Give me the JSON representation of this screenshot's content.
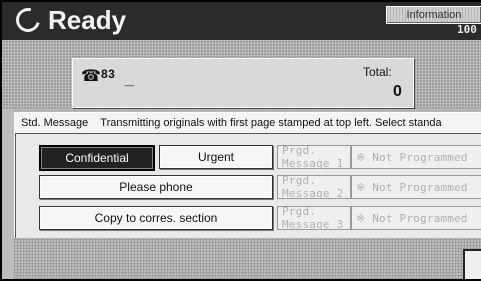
{
  "status": {
    "title": "Ready",
    "info_label": "Information",
    "percent_text": "100"
  },
  "destination": {
    "number": "83",
    "cursor": "_",
    "total_label": "Total:",
    "total_value": "0"
  },
  "dialog": {
    "title": "Std. Message",
    "description": "Transmitting originals with first page stamped at top left. Select standa",
    "buttons": [
      {
        "label": "Confidential",
        "selected": true
      },
      {
        "label": "Urgent",
        "selected": false
      },
      {
        "label": "Please phone",
        "selected": false
      },
      {
        "label": "Copy to corres. section",
        "selected": false
      }
    ],
    "programmed": [
      {
        "label": "Prgd. Message 1",
        "value": "※ Not Programmed"
      },
      {
        "label": "Prgd. Message 2",
        "value": "※ Not Programmed"
      },
      {
        "label": "Prgd. Message 3",
        "value": "※ Not Programmed"
      }
    ]
  },
  "icons": {
    "status": "refresh-icon",
    "destination": "phone-icon"
  }
}
